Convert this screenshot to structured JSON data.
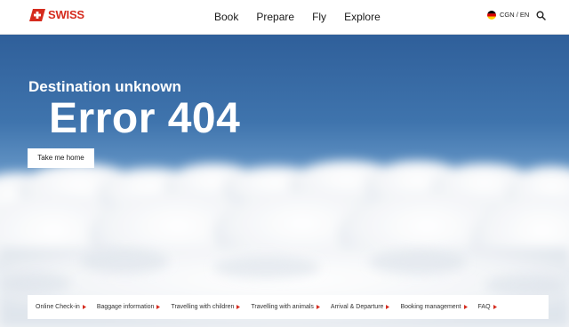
{
  "header": {
    "logo_text": "SWISS",
    "nav": [
      "Book",
      "Prepare",
      "Fly",
      "Explore"
    ],
    "language": "CGN / EN"
  },
  "hero": {
    "subtitle": "Destination unknown",
    "title": "Error 404",
    "button_label": "Take me home"
  },
  "quicklinks": [
    "Online Check-in",
    "Baggage information",
    "Travelling with children",
    "Travelling with animals",
    "Arrival & Departure",
    "Booking management",
    "FAQ"
  ],
  "colors": {
    "brand_red": "#d52b1e",
    "sky_blue": "#2f5f9a"
  }
}
